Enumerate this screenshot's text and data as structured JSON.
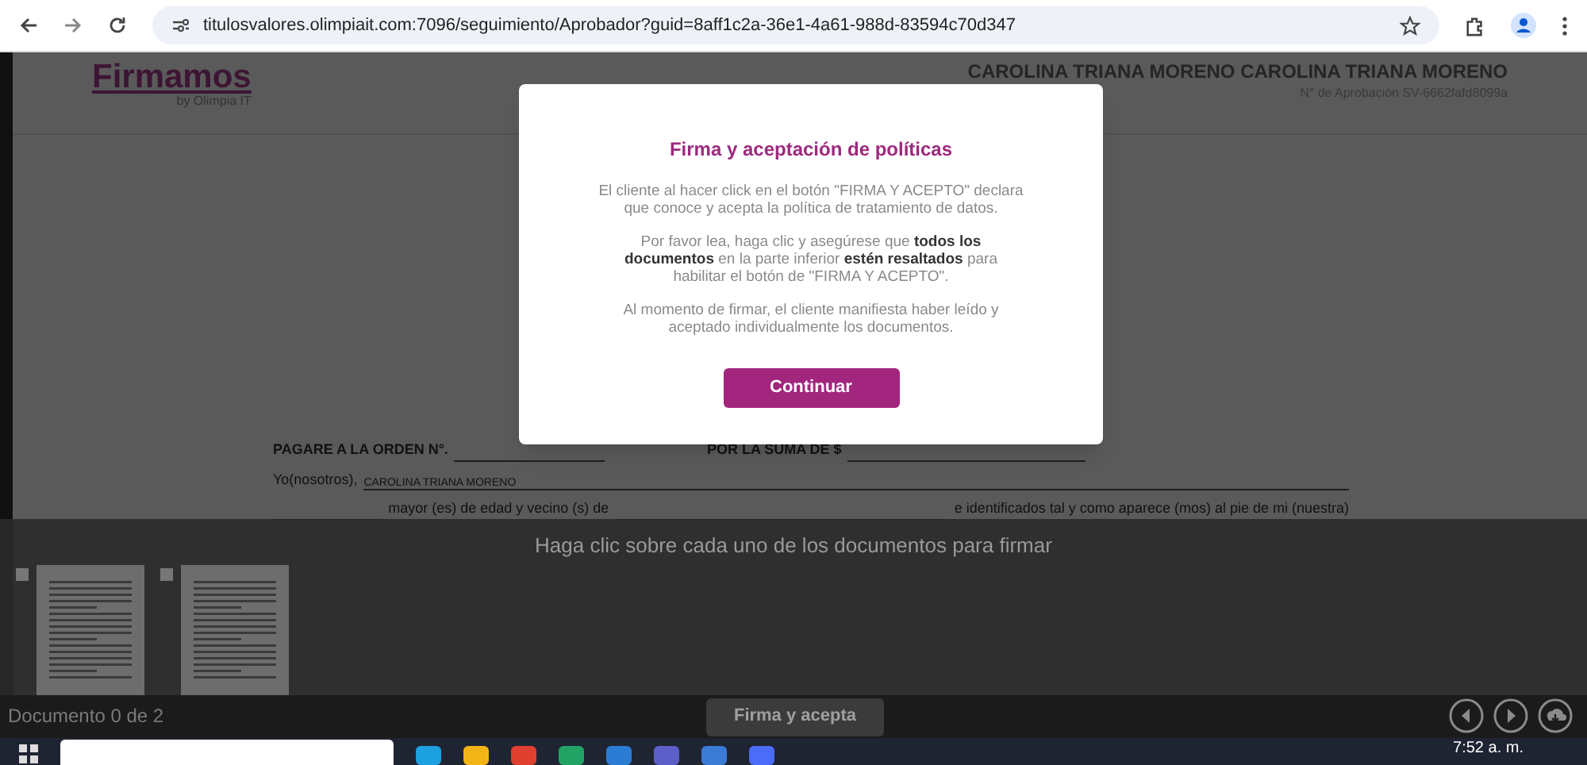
{
  "browser": {
    "url": "titulosvalores.olimpiait.com:7096/seguimiento/Aprobador?guid=8aff1c2a-36e1-4a61-988d-83594c70d347"
  },
  "header": {
    "logo": "Firmamos",
    "logo_sub": "by Olimpia IT",
    "client_name": "CAROLINA TRIANA MORENO CAROLINA TRIANA MORENO",
    "approval_number": "N° de Aprobación SV-6662fafd8099a"
  },
  "document": {
    "title": "PAGARE A LA ORDEN N°.",
    "amount_label": "POR LA SUMA DE $",
    "debtor_label": "Yo(nosotros),",
    "debtor_name": "CAROLINA TRIANA MORENO",
    "line_a": "mayor (es) de edad y vecino (s) de",
    "line_b": "e identificados tal y como aparece (mos) al pie de mi (nuestra)"
  },
  "modal": {
    "title": "Firma y aceptación de políticas",
    "paragraphs": [
      "El cliente al hacer click en el botón \"FIRMA Y ACEPTO\" declara que conoce y acepta la política de tratamiento de datos.",
      "Por favor lea, haga clic y asegúrese que **todos los documentos** en la parte inferior **estén resaltados** para habilitar el botón de \"FIRMA Y ACEPTO\".",
      "Al momento de firmar, el cliente manifiesta haber leído y aceptado individualmente los documentos."
    ],
    "button": "Continuar"
  },
  "documents_panel": {
    "hint": "Haga clic sobre cada uno de los documentos para firmar",
    "thumbnails": [
      {
        "checked": false
      },
      {
        "checked": false
      }
    ],
    "counter": "Documento 0 de 2",
    "sign_button": {
      "label": "Firma y acepta",
      "disabled": true
    }
  },
  "taskbar": {
    "time": "7:52 a. m."
  }
}
